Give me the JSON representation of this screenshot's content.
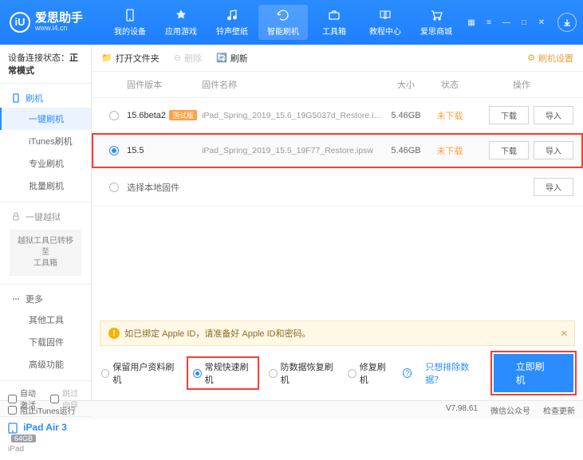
{
  "app": {
    "title": "爱思助手",
    "subtitle": "www.i4.cn",
    "logo_letter": "iU"
  },
  "nav": {
    "items": [
      {
        "label": "我的设备"
      },
      {
        "label": "应用游戏"
      },
      {
        "label": "铃声壁纸"
      },
      {
        "label": "智能刷机"
      },
      {
        "label": "工具箱"
      },
      {
        "label": "教程中心"
      },
      {
        "label": "爱思商城"
      }
    ]
  },
  "sidebar": {
    "conn_label": "设备连接状态：",
    "conn_value": "正常模式",
    "flash_header": "刷机",
    "flash_items": [
      "一键刷机",
      "iTunes刷机",
      "专业刷机",
      "批量刷机"
    ],
    "jailbreak_header": "一键越狱",
    "jailbreak_note": "越狱工具已转移至\n工具箱",
    "more_header": "更多",
    "more_items": [
      "其他工具",
      "下载固件",
      "高级功能"
    ],
    "auto_activate": "自动激活",
    "skip_guide": "跳过向导",
    "device_name": "iPad Air 3",
    "device_storage": "64GB",
    "device_type": "iPad",
    "block_itunes": "阻止iTunes运行"
  },
  "toolbar": {
    "open_folder": "打开文件夹",
    "delete": "删除",
    "refresh": "刷新",
    "settings": "刷机设置"
  },
  "table": {
    "headers": {
      "version": "固件版本",
      "name": "固件名称",
      "size": "大小",
      "status": "状态",
      "ops": "操作"
    },
    "rows": [
      {
        "version": "15.6beta2",
        "badge": "测试版",
        "name": "iPad_Spring_2019_15.6_19G5037d_Restore.i…",
        "size": "5.46GB",
        "status": "未下载",
        "selected": false
      },
      {
        "version": "15.5",
        "badge": "",
        "name": "iPad_Spring_2019_15.5_19F77_Restore.ipsw",
        "size": "5.46GB",
        "status": "未下载",
        "selected": true
      }
    ],
    "local_label": "选择本地固件",
    "download_btn": "下载",
    "import_btn": "导入"
  },
  "warn": {
    "text": "如已绑定 Apple ID，请准备好 Apple ID和密码。"
  },
  "modes": {
    "options": [
      "保留用户资料刷机",
      "常规快速刷机",
      "防数据恢复刷机",
      "修复刷机"
    ],
    "selected": 1,
    "exclude_link": "只想排除数据？",
    "flash_btn": "立即刷机"
  },
  "footer": {
    "version": "V7.98.61",
    "wechat": "微信公众号",
    "update": "检查更新"
  }
}
